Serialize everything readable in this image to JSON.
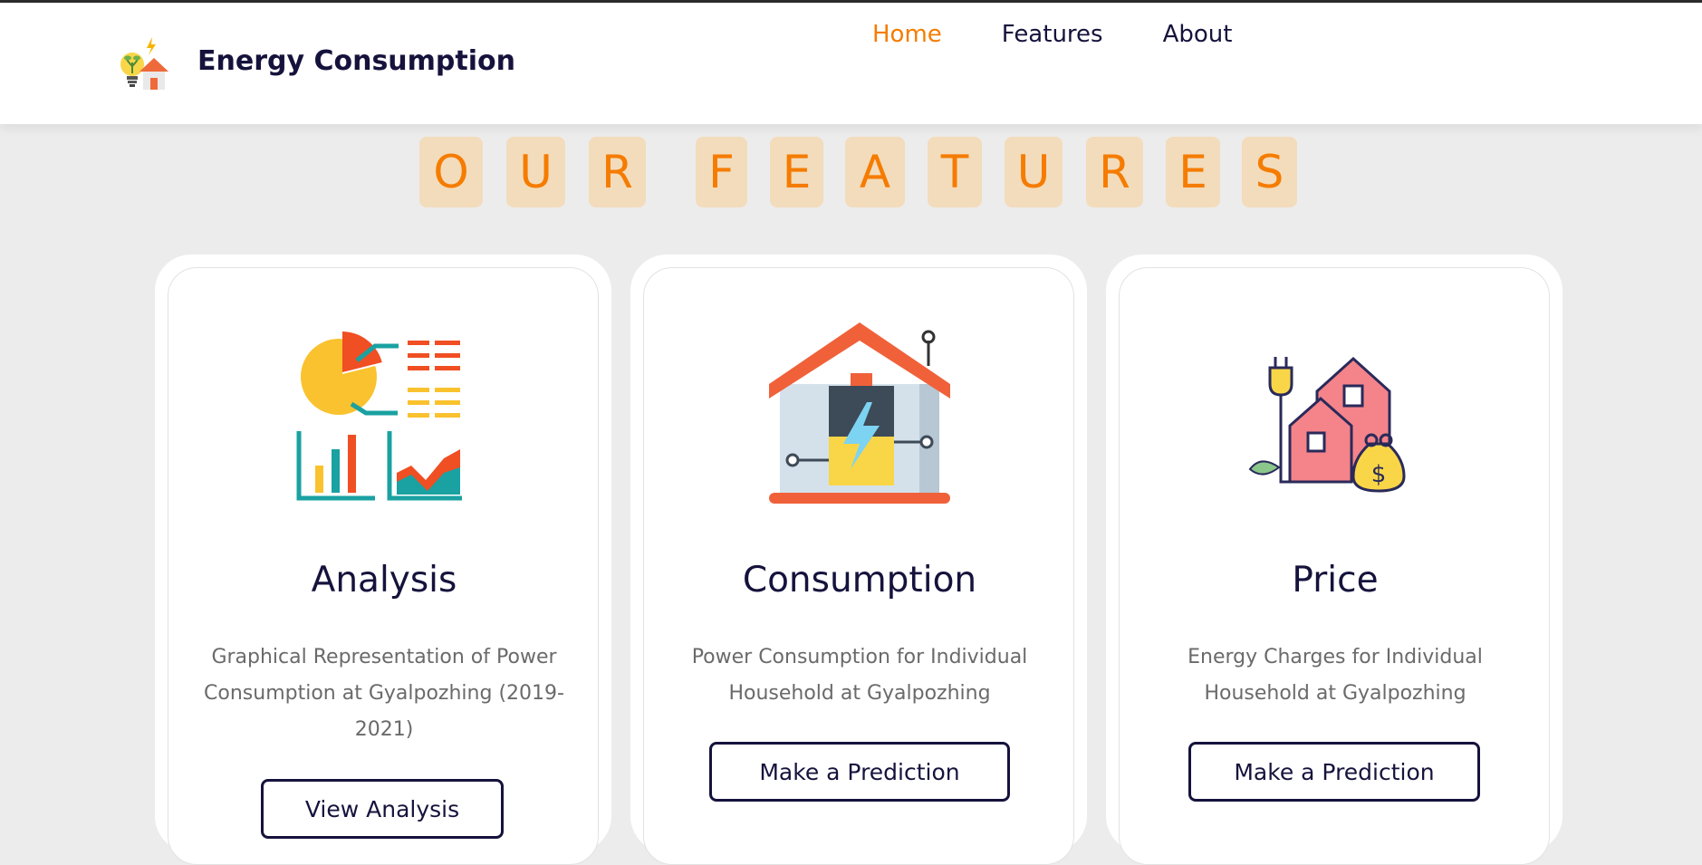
{
  "header": {
    "brand": "Energy Consumption",
    "nav": [
      {
        "label": "Home",
        "active": true
      },
      {
        "label": "Features",
        "active": false
      },
      {
        "label": "About",
        "active": false
      }
    ]
  },
  "section": {
    "title_letters": [
      "O",
      "U",
      "R",
      "F",
      "E",
      "A",
      "T",
      "U",
      "R",
      "E",
      "S"
    ]
  },
  "cards": [
    {
      "icon": "analytics-charts-icon",
      "title": "Analysis",
      "description": "Graphical Representation of Power Consumption at Gyalpozhing (2019-2021)",
      "button": "View Analysis"
    },
    {
      "icon": "smart-house-battery-icon",
      "title": "Consumption",
      "description": "Power Consumption for Individual Household at Gyalpozhing",
      "button": "Make a Prediction"
    },
    {
      "icon": "house-money-plug-icon",
      "title": "Price",
      "description": "Energy Charges for Individual Household at Gyalpozhing",
      "button": "Make a Prediction"
    }
  ],
  "colors": {
    "accent": "#f57c00",
    "tile_bg": "#f3dcbc",
    "navy": "#15133c",
    "page_bg": "#ececec"
  }
}
